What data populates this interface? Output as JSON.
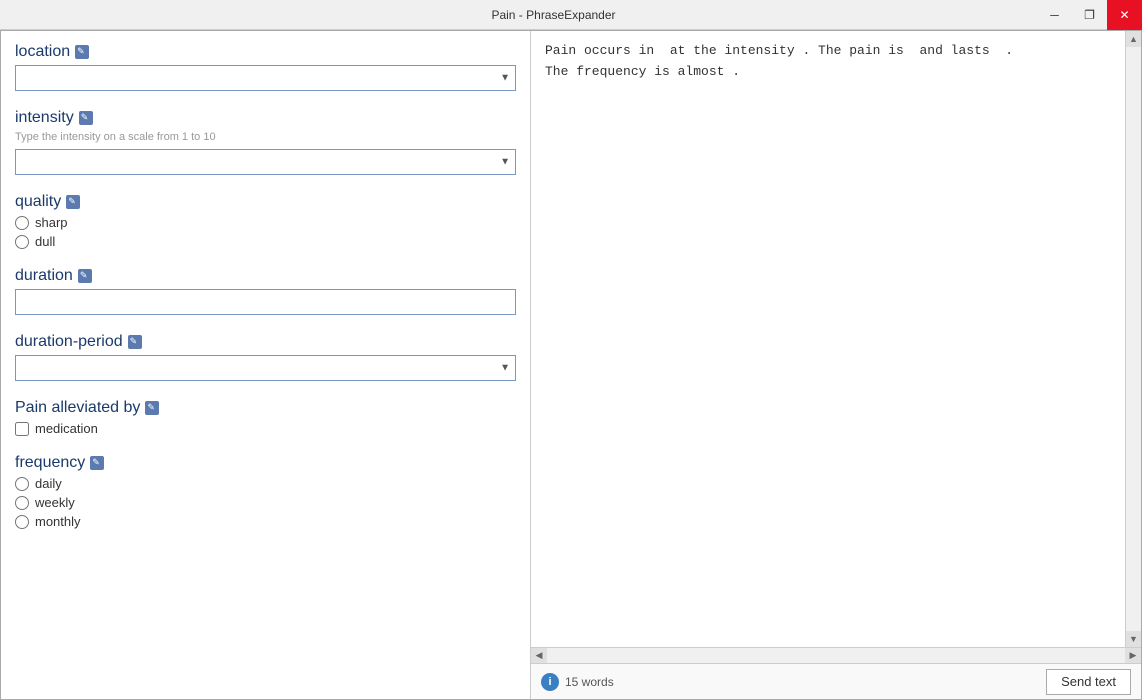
{
  "titleBar": {
    "title": "Pain - PhraseExpander",
    "minimizeLabel": "─",
    "restoreLabel": "❐",
    "closeLabel": "✕"
  },
  "leftPanel": {
    "sections": [
      {
        "id": "location",
        "label": "location",
        "type": "select",
        "hint": "",
        "options": [
          ""
        ],
        "editIconTitle": "Edit location"
      },
      {
        "id": "intensity",
        "label": "intensity",
        "type": "select",
        "hint": "Type the intensity on a scale from 1 to 10",
        "options": [
          ""
        ],
        "editIconTitle": "Edit intensity"
      },
      {
        "id": "quality",
        "label": "quality",
        "type": "radio",
        "hint": "",
        "options": [
          "sharp",
          "dull"
        ],
        "editIconTitle": "Edit quality"
      },
      {
        "id": "duration",
        "label": "duration",
        "type": "text",
        "hint": "",
        "placeholder": "",
        "editIconTitle": "Edit duration"
      },
      {
        "id": "duration-period",
        "label": "duration-period",
        "type": "select",
        "hint": "",
        "options": [
          ""
        ],
        "editIconTitle": "Edit duration-period"
      },
      {
        "id": "pain-alleviated-by",
        "label": "Pain alleviated by",
        "type": "checkbox",
        "hint": "",
        "options": [
          "medication"
        ],
        "editIconTitle": "Edit Pain alleviated by"
      },
      {
        "id": "frequency",
        "label": "frequency",
        "type": "radio",
        "hint": "",
        "options": [
          "daily",
          "weekly",
          "monthly"
        ],
        "editIconTitle": "Edit frequency"
      }
    ]
  },
  "rightPanel": {
    "previewText": "Pain occurs in  at the intensity . The pain is  and lasts  .\nThe frequency is almost ."
  },
  "bottomBar": {
    "wordCount": "15 words",
    "infoIconLabel": "i",
    "sendTextLabel": "Send text"
  }
}
